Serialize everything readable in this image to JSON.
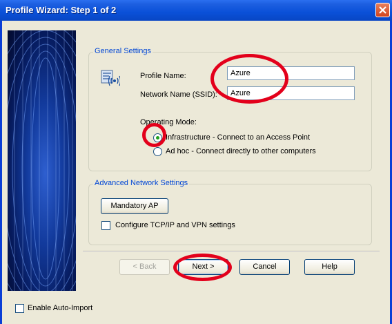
{
  "window": {
    "title": "Profile Wizard: Step 1 of 2"
  },
  "general": {
    "legend": "General Settings",
    "profile_name_label": "Profile Name:",
    "profile_name_value": "Azure",
    "network_name_label": "Network Name (SSID):",
    "network_name_value": "Azure",
    "operating_mode_label": "Operating Mode:",
    "mode_infrastructure": "Infrastructure - Connect to an Access Point",
    "mode_adhoc": "Ad hoc - Connect directly to other computers",
    "selected_mode": "infrastructure",
    "icon": "network-profile-icon"
  },
  "advanced": {
    "legend": "Advanced Network Settings",
    "mandatory_ap_label": "Mandatory AP",
    "tcpip_label": "Configure TCP/IP and VPN settings",
    "tcpip_checked": false
  },
  "buttons": {
    "back": "< Back",
    "next": "Next >",
    "cancel": "Cancel",
    "help": "Help"
  },
  "footer": {
    "auto_import_label": "Enable Auto-Import",
    "auto_import_checked": false
  },
  "colors": {
    "titlebar": "#0a50d8",
    "legend_text": "#0046d5",
    "annotation": "#e3001b"
  }
}
